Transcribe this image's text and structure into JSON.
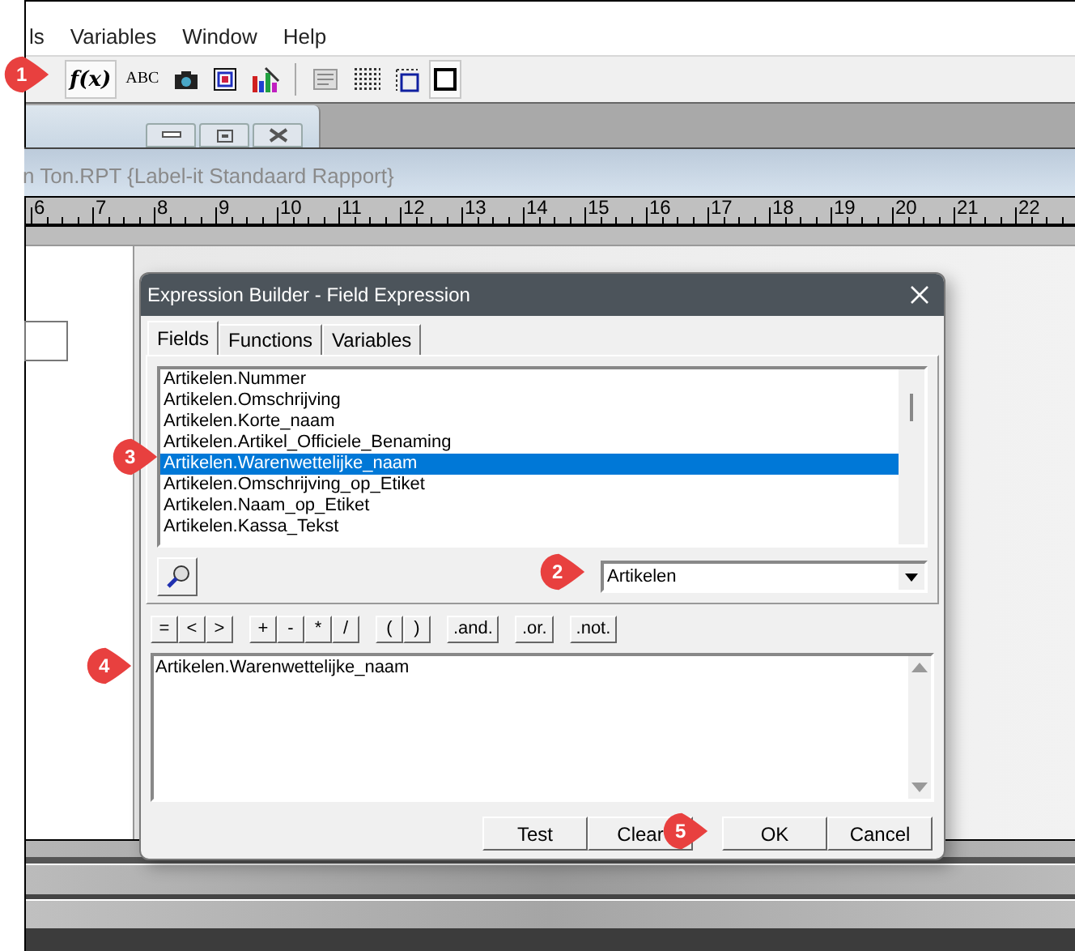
{
  "menu_bar": {
    "items": [
      "ls",
      "Variables",
      "Window",
      "Help"
    ]
  },
  "toolbar": [
    {
      "kind": "formula",
      "label": "f(x)",
      "selected": true
    },
    {
      "kind": "text",
      "label": "ABC",
      "selected": false
    },
    {
      "kind": "camera",
      "selected": false
    },
    {
      "kind": "frame",
      "selected": false
    },
    {
      "kind": "chart",
      "selected": false
    },
    {
      "kind": "separator"
    },
    {
      "kind": "textframe",
      "selected": false
    },
    {
      "kind": "grid",
      "selected": false
    },
    {
      "kind": "snap",
      "selected": false
    },
    {
      "kind": "box",
      "selected": true
    }
  ],
  "document": {
    "title": "n Ton.RPT {Label-it Standaard Rapport}",
    "ruler": [
      "6",
      "7",
      "8",
      "9",
      "10",
      "11",
      "12",
      "13",
      "14",
      "15",
      "16",
      "17",
      "18",
      "19",
      "20",
      "21",
      "22"
    ]
  },
  "dialog": {
    "title": "Expression Builder - Field Expression",
    "tabs": [
      {
        "label": "Fields",
        "selected": true
      },
      {
        "label": "Functions",
        "selected": false
      },
      {
        "label": "Variables",
        "selected": false
      }
    ],
    "fields": [
      {
        "label": "Artikelen.Nummer",
        "selected": false
      },
      {
        "label": "Artikelen.Omschrijving",
        "selected": false
      },
      {
        "label": "Artikelen.Korte_naam",
        "selected": false
      },
      {
        "label": "Artikelen.Artikel_Officiele_Benaming",
        "selected": false
      },
      {
        "label": "Artikelen.Warenwettelijke_naam",
        "selected": true
      },
      {
        "label": "Artikelen.Omschrijving_op_Etiket",
        "selected": false
      },
      {
        "label": "Artikelen.Naam_op_Etiket",
        "selected": false
      },
      {
        "label": "Artikelen.Kassa_Tekst",
        "selected": false
      }
    ],
    "table_select": {
      "value": "Artikelen"
    },
    "operators": [
      [
        "=",
        "<",
        ">"
      ],
      [
        "+",
        "-",
        "*",
        "/"
      ],
      [
        "(",
        ")"
      ],
      [
        ".and."
      ],
      [
        ".or."
      ],
      [
        ".not."
      ]
    ],
    "expression": {
      "value": "Artikelen.Warenwettelijke_naam"
    },
    "buttons": [
      "Test",
      "Clear",
      "OK",
      "Cancel"
    ]
  },
  "callouts": [
    {
      "number": "1"
    },
    {
      "number": "2"
    },
    {
      "number": "3"
    },
    {
      "number": "4"
    },
    {
      "number": "5"
    }
  ]
}
